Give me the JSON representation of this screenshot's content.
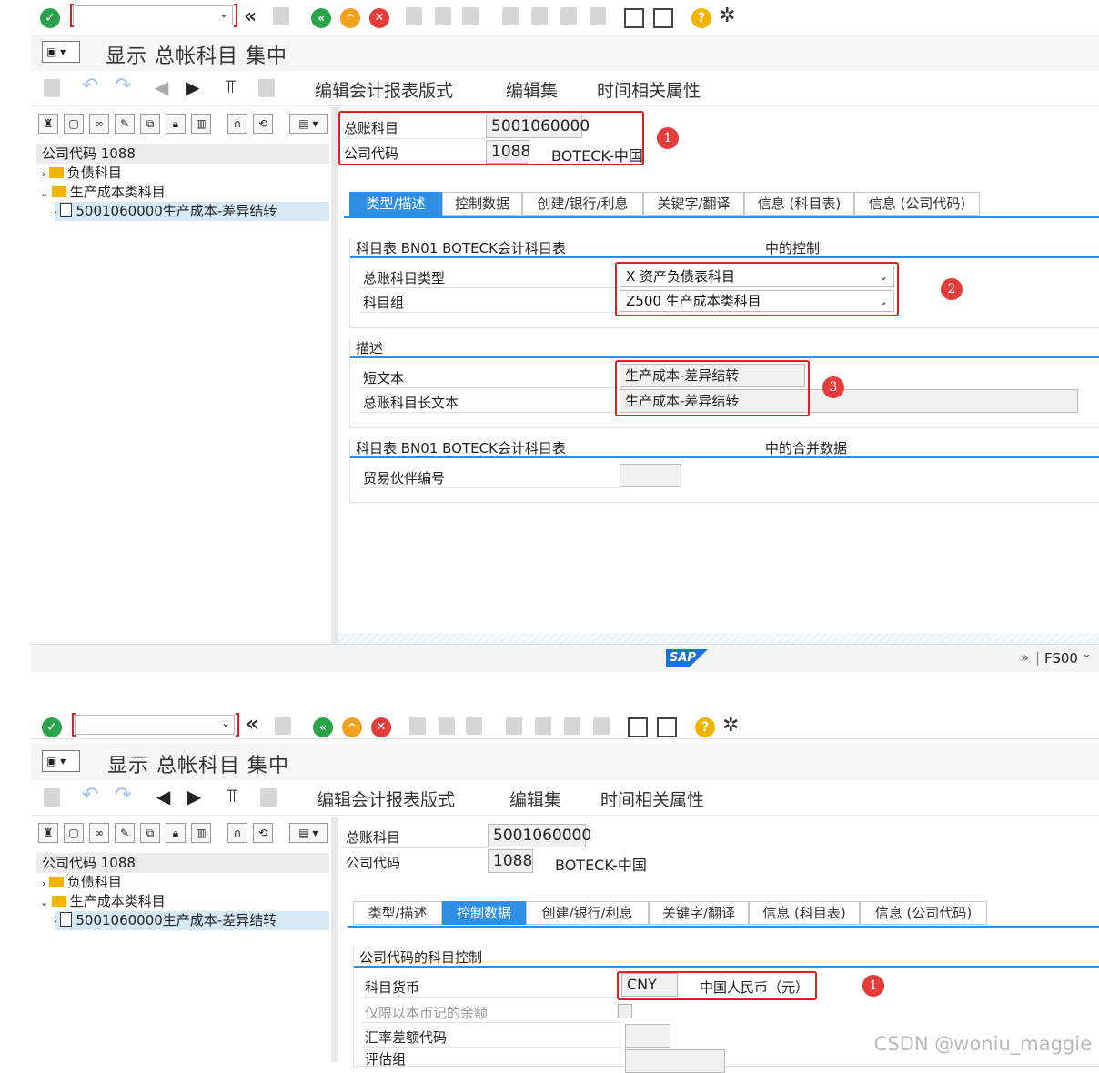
{
  "toolbar": {
    "command_field_value": "",
    "icons": [
      "enter-icon",
      "back-icon",
      "save-icon",
      "back-green-icon",
      "exit-icon",
      "cancel-icon",
      "print-icon",
      "find-icon",
      "find-next-icon",
      "first-page-icon",
      "prev-page-icon",
      "next-page-icon",
      "last-page-icon",
      "new-session-icon",
      "shortcut-icon",
      "help-icon",
      "settings-icon"
    ]
  },
  "title": {
    "text": "显示 总帐科目 集中"
  },
  "app_toolbar": {
    "menu1": "编辑会计报表版式",
    "menu2": "编辑集",
    "menu3": "时间相关属性"
  },
  "tree": {
    "header": "公司代码 1088",
    "items": [
      {
        "label": "负债科目"
      },
      {
        "label": "生产成本类科目"
      },
      {
        "label": "5001060000生产成本-差异结转"
      }
    ]
  },
  "header_fields": {
    "gl_account_label": "总账科目",
    "gl_account_value": "5001060000",
    "company_code_label": "公司代码",
    "company_code_value": "1088",
    "company_name": "BOTECK-中国"
  },
  "tabs": [
    "类型/描述",
    "控制数据",
    "创建/银行/利息",
    "关键字/翻译",
    "信息 (科目表)",
    "信息 (公司代码)"
  ],
  "panel1": {
    "control_group": {
      "title": "科目表 BN01 BOTECK会计科目表",
      "title_right": "中的控制",
      "gl_type_label": "总账科目类型",
      "gl_type_value": "X 资产负债表科目",
      "acct_group_label": "科目组",
      "acct_group_value": "Z500 生产成本类科目"
    },
    "desc_group": {
      "title": "描述",
      "short_text_label": "短文本",
      "short_text_value": "生产成本-差异结转",
      "long_text_label": "总账科目长文本",
      "long_text_value": "生产成本-差异结转"
    },
    "consol_group": {
      "title": "科目表 BN01 BOTECK会计科目表",
      "title_right": "中的合并数据",
      "partner_label": "贸易伙伴编号",
      "partner_value": ""
    },
    "badges": [
      "1",
      "2",
      "3"
    ]
  },
  "status": {
    "logo": "SAP",
    "transaction": "FS00",
    "arrows": "»"
  },
  "panel2": {
    "group": {
      "title": "公司代码的科目控制",
      "currency_label": "科目货币",
      "currency_value": "CNY",
      "currency_text": "中国人民币（元）",
      "local_only_label": "仅限以本币记的余额",
      "exch_diff_label": "汇率差额代码",
      "valuation_label": "评估组"
    },
    "badge": "1"
  },
  "watermark": "CSDN @woniu_maggie",
  "colors": {
    "accent": "#2f8fe4",
    "highlight": "#e02020",
    "tree_selected": "#d7e8f6"
  }
}
